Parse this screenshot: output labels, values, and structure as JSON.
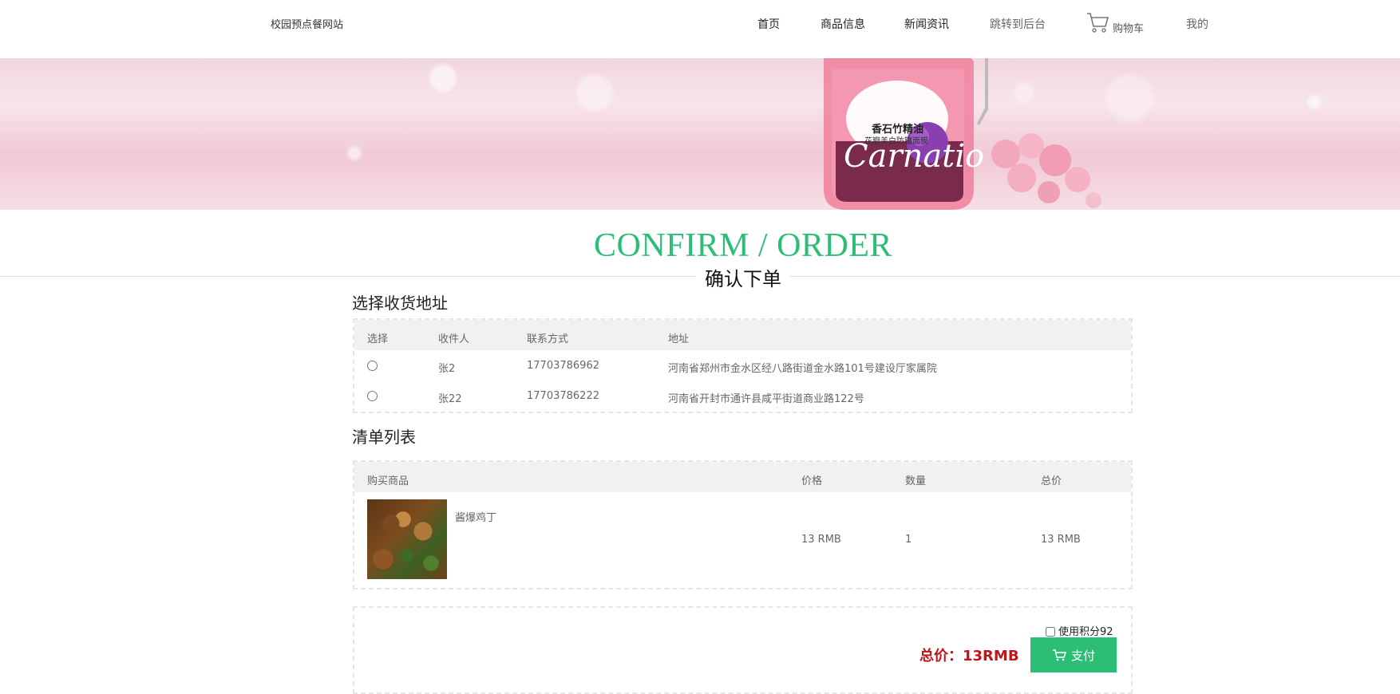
{
  "header": {
    "site_title": "校园预点餐网站",
    "nav": [
      "首页",
      "商品信息",
      "新闻资讯",
      "跳转到后台"
    ],
    "cart_label": "购物车",
    "mine_label": "我的"
  },
  "banner": {
    "label_main": "香石竹精油",
    "label_sub": "花瓣美白防辐面膜",
    "script": "Carnatio"
  },
  "title": {
    "en": "CONFIRM / ORDER",
    "cn": "确认下单"
  },
  "address_section": {
    "heading": "选择收货地址",
    "columns": [
      "选择",
      "收件人",
      "联系方式",
      "地址"
    ],
    "rows": [
      {
        "name": "张2",
        "phone": "17703786962",
        "address": "河南省郑州市金水区经八路街道金水路101号建设厅家属院"
      },
      {
        "name": "张22",
        "phone": "17703786222",
        "address": "河南省开封市通许县咸平街道商业路122号"
      }
    ]
  },
  "order_section": {
    "heading": "清单列表",
    "columns": [
      "购买商品",
      "价格",
      "数量",
      "总价"
    ],
    "items": [
      {
        "name": "酱爆鸡丁",
        "price": "13 RMB",
        "qty": "1",
        "total": "13 RMB"
      }
    ]
  },
  "payment": {
    "points_label": "使用积分92",
    "total_label": "总价：13RMB",
    "pay_label": "支付"
  },
  "colors": {
    "accent": "#2dbe76",
    "price": "#c0161b"
  }
}
